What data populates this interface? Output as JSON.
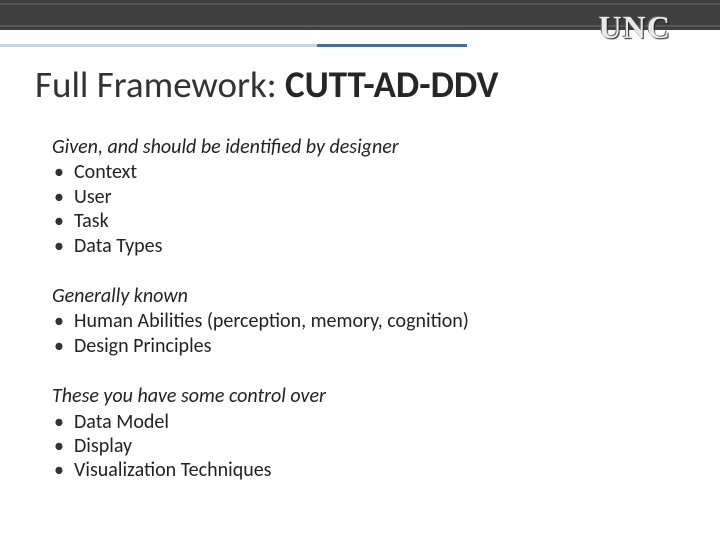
{
  "logo": "UNC",
  "title": {
    "prefix": "Full Framework:  ",
    "main": "CUTT-AD-DDV"
  },
  "sections": [
    {
      "heading": "Given, and should be identified by designer",
      "items": [
        "Context",
        "User",
        "Task",
        "Data Types"
      ]
    },
    {
      "heading": "Generally known",
      "items": [
        "Human Abilities (perception, memory, cognition)",
        "Design Principles"
      ]
    },
    {
      "heading": "These you have some control over",
      "items": [
        "Data Model",
        "Display",
        "Visualization Techniques"
      ]
    }
  ]
}
